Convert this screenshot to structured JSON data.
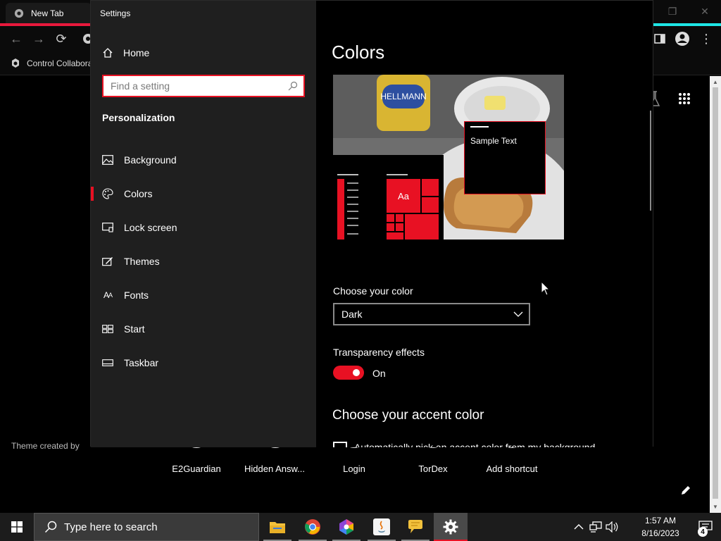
{
  "browser": {
    "tab_title": "New Tab",
    "bookmark_label": "Control Collabora",
    "theme_credit": "Theme created by",
    "shortcuts": [
      {
        "label": "E2Guardian"
      },
      {
        "label": "Hidden Answ..."
      },
      {
        "label": "Login"
      },
      {
        "label": "TorDex"
      },
      {
        "label": "Add shortcut"
      }
    ]
  },
  "settings": {
    "window_title": "Settings",
    "home_label": "Home",
    "search_placeholder": "Find a setting",
    "section_label": "Personalization",
    "nav_items": [
      {
        "label": "Background",
        "icon": "picture-icon"
      },
      {
        "label": "Colors",
        "icon": "palette-icon",
        "active": true
      },
      {
        "label": "Lock screen",
        "icon": "lock-screen-icon"
      },
      {
        "label": "Themes",
        "icon": "themes-icon"
      },
      {
        "label": "Fonts",
        "icon": "fonts-icon"
      },
      {
        "label": "Start",
        "icon": "start-icon"
      },
      {
        "label": "Taskbar",
        "icon": "taskbar-icon"
      }
    ],
    "page_title": "Colors",
    "preview": {
      "sample_text": "Sample Text",
      "tile_text": "Aa"
    },
    "choose_color_label": "Choose your color",
    "choose_color_value": "Dark",
    "transparency_label": "Transparency effects",
    "transparency_state": "On",
    "accent_title": "Choose your accent color",
    "auto_pick_text": "Automatically pick an accent color from my background",
    "accent_color": "#e81123"
  },
  "taskbar": {
    "search_placeholder": "Type here to search",
    "time": "1:57 AM",
    "date": "8/16/2023",
    "notification_count": "4"
  }
}
